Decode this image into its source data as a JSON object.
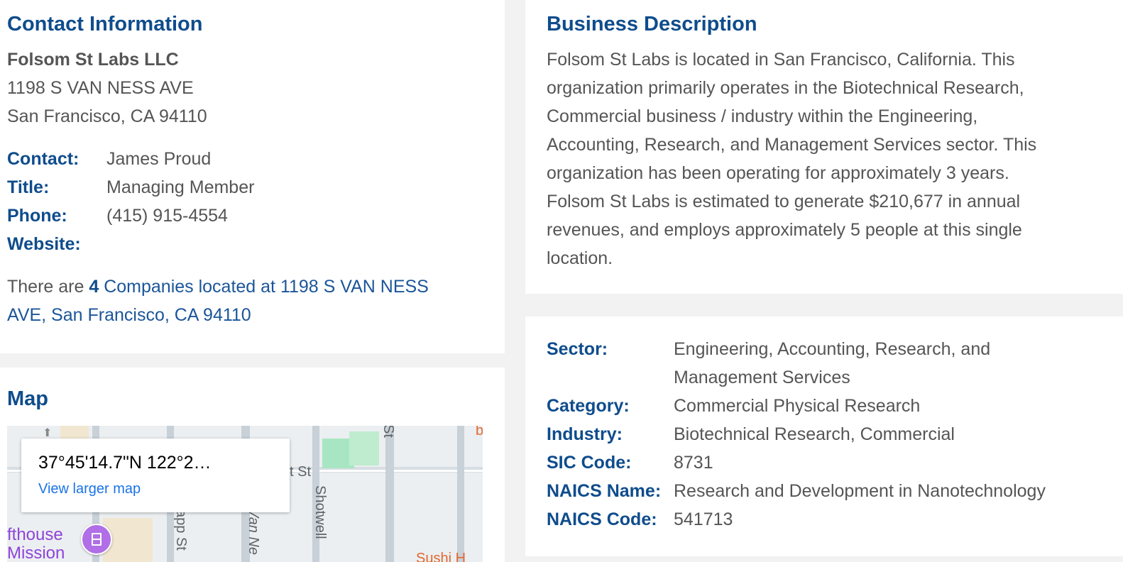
{
  "contact": {
    "heading": "Contact Information",
    "company_name": "Folsom St Labs LLC",
    "address_line1": "1198 S VAN NESS AVE",
    "address_line2": "San Francisco, CA 94110",
    "fields": [
      {
        "label": "Contact:",
        "value": "James Proud"
      },
      {
        "label": "Title:",
        "value": "Managing Member"
      },
      {
        "label": "Phone:",
        "value": "(415) 915-4554"
      },
      {
        "label": "Website:",
        "value": ""
      }
    ],
    "companies_prefix": "There are ",
    "companies_count": "4",
    "companies_link_line1": " Companies located at 1198 S VAN NESS",
    "companies_link_line2": "AVE, San Francisco, CA 94110"
  },
  "map": {
    "heading": "Map",
    "coords": "37°45'14.7\"N 122°2…",
    "view_larger": "View larger map",
    "labels": {
      "street_st": "St",
      "street_t_st": "t St",
      "shotwell": "Shotwell",
      "van_ness": "Van Ne",
      "app_st": "app St",
      "fthouse": "fthouse",
      "mission": "Mission",
      "sushi": "Sushi H",
      "b": "b"
    }
  },
  "business": {
    "heading": "Business Description",
    "lines": [
      "Folsom St Labs is located in San Francisco, California. This",
      "organization primarily operates in the Biotechnical Research,",
      "Commercial business / industry within the Engineering,",
      "Accounting, Research, and Management Services sector. This",
      "organization has been operating for approximately 3 years.",
      "Folsom St Labs is estimated to generate $210,677 in annual",
      "revenues, and employs approximately 5 people at this single",
      "location."
    ]
  },
  "classification": {
    "fields": [
      {
        "label": "Sector:",
        "value": "Engineering, Accounting, Research, and",
        "value2": "Management Services"
      },
      {
        "label": "Category:",
        "value": "Commercial Physical Research"
      },
      {
        "label": "Industry:",
        "value": "Biotechnical Research, Commercial"
      },
      {
        "label": "SIC Code:",
        "value": "8731"
      },
      {
        "label": "NAICS Name:",
        "value": "Research and Development in Nanotechnology"
      },
      {
        "label": "NAICS Code:",
        "value": "541713"
      }
    ]
  }
}
